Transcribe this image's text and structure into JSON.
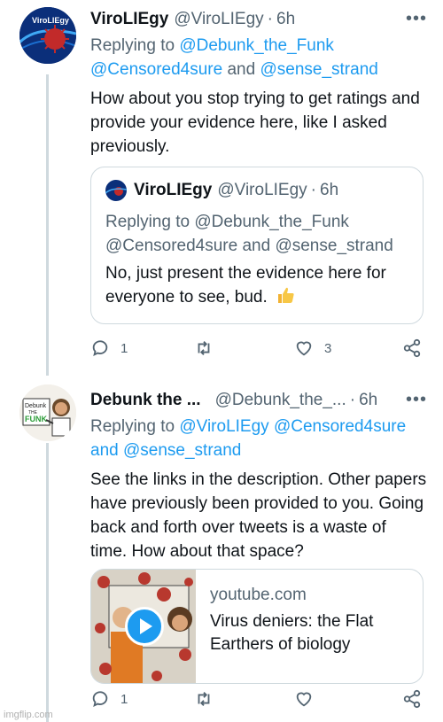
{
  "tweet1": {
    "name": "ViroLIEgy",
    "handle": "@ViroLIEgy",
    "time": "6h",
    "more": "•••",
    "replying_prefix": "Replying to",
    "mentions": [
      "@Debunk_the_Funk",
      "@Censored4sure",
      "@sense_strand"
    ],
    "and": "and",
    "text": "How about you stop trying to get ratings and provide your evidence here, like I asked previously.",
    "avatar_label": "ViroLIEgy",
    "quote": {
      "name": "ViroLIEgy",
      "handle": "@ViroLIEgy",
      "time": "6h",
      "replying": "Replying to @Debunk_the_Funk @Censored4sure and @sense_strand",
      "text": "No, just present the evidence here for everyone to see, bud."
    },
    "replies": "1",
    "retweets": "",
    "likes": "3"
  },
  "tweet2": {
    "name": "Debunk the ...",
    "handle": "@Debunk_the_...",
    "time": "6h",
    "more": "•••",
    "replying_prefix": "Replying to",
    "mentions": [
      "@ViroLIEgy",
      "@Censored4sure",
      "@sense_strand"
    ],
    "and": "and",
    "text": "See the links in the description. Other papers have previously been provided to you. Going back and forth over tweets is a waste of time. How about that space?",
    "avatar_label": "Debunk The Funk",
    "card": {
      "domain": "youtube.com",
      "title": "Virus deniers: the Flat Earthers of biology"
    },
    "replies": "1",
    "retweets": "",
    "likes": ""
  },
  "watermark": "imgflip.com",
  "colors": {
    "link": "#1d9bf0",
    "muted": "#536471",
    "border": "#cfd9de"
  }
}
